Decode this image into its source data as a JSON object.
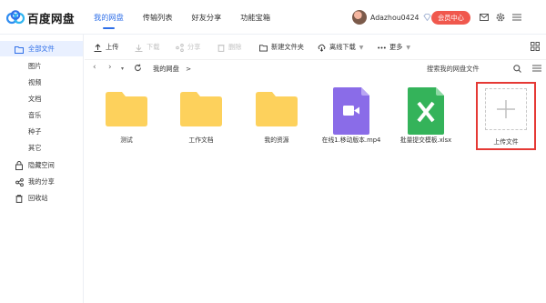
{
  "app": {
    "logo_text": "百度网盘"
  },
  "nav": {
    "tabs": [
      {
        "label": "我的网盘"
      },
      {
        "label": "传输列表"
      },
      {
        "label": "好友分享"
      },
      {
        "label": "功能宝箱"
      }
    ],
    "active_index": 0
  },
  "user": {
    "name": "Adazhou0424",
    "vip_button": "会员中心"
  },
  "sidebar": {
    "items": [
      {
        "label": "全部文件",
        "icon": "folder-icon"
      },
      {
        "label": "图片"
      },
      {
        "label": "视频"
      },
      {
        "label": "文档"
      },
      {
        "label": "音乐"
      },
      {
        "label": "种子"
      },
      {
        "label": "其它"
      },
      {
        "label": "隐藏空间",
        "icon": "lock-icon"
      },
      {
        "label": "我的分享",
        "icon": "share-icon"
      },
      {
        "label": "回收站",
        "icon": "trash-icon"
      }
    ]
  },
  "toolbar": {
    "upload": "上传",
    "download": "下载",
    "share": "分享",
    "delete": "删除",
    "new_folder": "新建文件夹",
    "offline_download": "离线下载",
    "more": "更多"
  },
  "pathbar": {
    "crumb": "我的网盘",
    "crumb_sep": ">",
    "search_placeholder": "搜索我的网盘文件"
  },
  "files": [
    {
      "name": "测试",
      "type": "folder"
    },
    {
      "name": "工作文档",
      "type": "folder"
    },
    {
      "name": "我的资源",
      "type": "folder"
    },
    {
      "name": "在线1.移动版本.mp4",
      "type": "video"
    },
    {
      "name": "批量提交模板.xlsx",
      "type": "excel"
    }
  ],
  "upload_tile": {
    "label": "上传文件"
  },
  "colors": {
    "accent": "#2f6fe8",
    "vip": "#f0584d",
    "folder": "#fdd15c",
    "video": "#8a6ce8",
    "excel": "#34b35a",
    "highlight": "#e53935"
  }
}
